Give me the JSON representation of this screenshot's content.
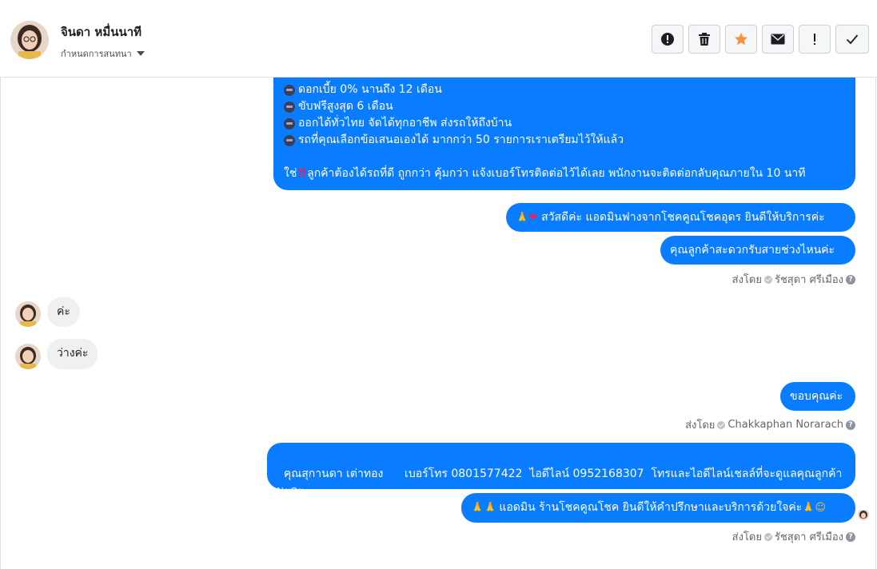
{
  "contact": {
    "name": "จินดา หมื่นนาที",
    "assign_label": "กำหนดการสนทนา"
  },
  "toolbar": {
    "icons": [
      "alert-icon",
      "trash-icon",
      "star-icon",
      "mail-icon",
      "exclamation-icon",
      "check-icon"
    ],
    "star_color": "#f7923a"
  },
  "colors": {
    "bubble_out": "#0a7cff",
    "bubble_in": "#f1f0f0"
  },
  "messages": {
    "promo": {
      "lines": [
        "ดอกเบี้ย 0% นานถึง 12 เดือน",
        "ขับฟรีสูงสุด 6 เดือน",
        "ออกได้ทั่วไทย จัดได้ทุกอาชีพ ส่งรถให้ถึงบ้าน",
        "รถที่คุณเลือกข้อเสนอเองได้ มากกว่า 50 รายการเราเตรียมไว้ให้แล้ว"
      ],
      "cta_prefix": "ใช่",
      "cta_text": "ลูกค้าต้องได้รถที่ดี ถูกกว่า คุ้มกว่า แจ้งเบอร์โทรติดต่อไว้ได้เลย พนักงานจะติดต่อกลับคุณภายใน 10 นาที"
    },
    "greeting": "สวัสดีค่ะ แอดมินฟางจากโชคคูณโชคอุดร ยินดีให้บริการค่ะ",
    "ask_time": "คุณลูกค้าสะดวกรับสายช่วงไหนค่ะ",
    "sent_by_1": {
      "prefix": "ส่งโดย",
      "name": "รัชสุดา ศรีเมือง"
    },
    "reply_1": "ค่ะ",
    "reply_2": "ว่างค่ะ",
    "thanks": "ขอบคุณค่ะ",
    "sent_by_2": {
      "prefix": "ส่งโดย",
      "name": "Chakkaphan Norarach"
    },
    "info": "คุณสุกานดา เต่าทอง      เบอร์โทร 0801577422  ไอดีไลน์ 0952168307  โทรและไอดีไลน์เชลล์ที่จะดูแลคุณลูกค้านะคะ",
    "closing": "แอดมิน ร้านโชคคูณโชค ยินดีให้คำปรึกษาและบริการด้วยใจค่ะ",
    "sent_by_3": {
      "prefix": "ส่งโดย",
      "name": "รัชสุดา ศรีเมือง"
    }
  }
}
